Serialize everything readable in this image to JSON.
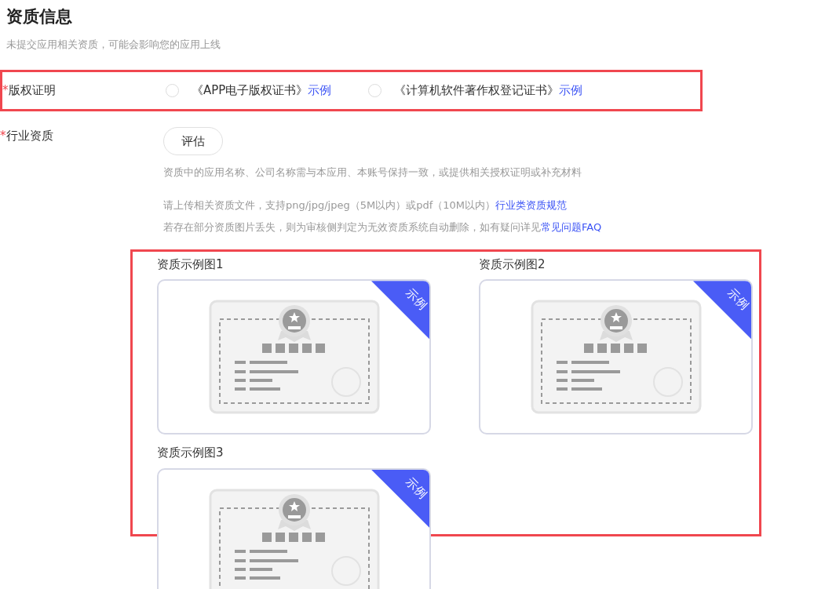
{
  "header": {
    "title": "资质信息",
    "subtitle": "未提交应用相关资质，可能会影响您的应用上线"
  },
  "copyright": {
    "label": "版权证明",
    "required_mark": "*",
    "highlighted": true,
    "options": [
      {
        "label": "《APP电子版权证书》",
        "link": "示例",
        "selected": false
      },
      {
        "label": "《计算机软件著作权登记证书》",
        "link": "示例",
        "selected": false
      }
    ]
  },
  "industry": {
    "label": "行业资质",
    "required_mark": "*",
    "button": "评估",
    "note": "资质中的应用名称、公司名称需与本应用、本账号保持一致，或提供相关授权证明或补充材料",
    "hints": [
      {
        "text": "请上传相关资质文件，支持png/jpg/jpeg（5M以内）或pdf（10M以内）",
        "link": "行业类资质规范"
      },
      {
        "text": "若存在部分资质图片丢失，则为审核侧判定为无效资质系统自动删除，如有疑问详见 ",
        "link": "常见问题FAQ"
      }
    ],
    "examples_highlighted": true,
    "examples": [
      {
        "title": "资质示例图1",
        "ribbon": "示例"
      },
      {
        "title": "资质示例图2",
        "ribbon": "示例"
      },
      {
        "title": "资质示例图3",
        "ribbon": "示例"
      }
    ]
  }
}
